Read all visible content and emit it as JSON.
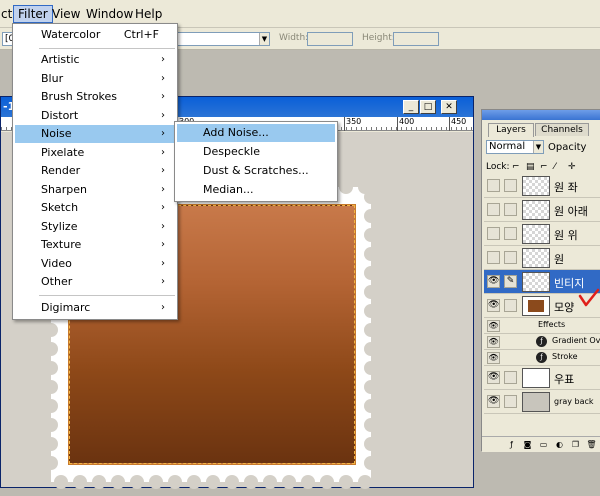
{
  "menubar": {
    "items": [
      {
        "label": "ct"
      },
      {
        "label": "Filter"
      },
      {
        "label": "View"
      },
      {
        "label": "Window"
      },
      {
        "label": "Help"
      }
    ]
  },
  "options": {
    "field_value": "[0",
    "width_label": "Width:",
    "height_label": "Height:"
  },
  "document": {
    "title": "-1",
    "ruler_ticks": [
      "300",
      "350",
      "400",
      "450"
    ]
  },
  "filter_menu": {
    "last_filter": "Watercolor",
    "last_filter_shortcut": "Ctrl+F",
    "items": [
      "Artistic",
      "Blur",
      "Brush Strokes",
      "Distort",
      "Noise",
      "Pixelate",
      "Render",
      "Sharpen",
      "Sketch",
      "Stylize",
      "Texture",
      "Video",
      "Other"
    ],
    "plugin": "Digimarc",
    "highlighted": "Noise"
  },
  "noise_menu": {
    "items": [
      "Add Noise...",
      "Despeckle",
      "Dust & Scratches...",
      "Median..."
    ],
    "highlighted": "Add Noise..."
  },
  "layers_panel": {
    "tabs": [
      "Layers",
      "Channels"
    ],
    "blend_mode": "Normal",
    "opacity_label": "Opacity",
    "lock_label": "Lock:",
    "layers": [
      {
        "name": "원 좌"
      },
      {
        "name": "원 아래"
      },
      {
        "name": "원 위"
      },
      {
        "name": "원"
      },
      {
        "name": "빈티지"
      },
      {
        "name": "모양"
      }
    ],
    "effects_label": "Effects",
    "effects": [
      "Gradient Ove",
      "Stroke"
    ],
    "bottom_layers": [
      {
        "name": "우표"
      },
      {
        "name": "gray back"
      }
    ]
  },
  "colors": {
    "menu_highlight": "#99c9ef",
    "selected_layer": "#316ac5",
    "stamp_top": "#c8794a",
    "stamp_bottom": "#6b3310",
    "annotation_red": "#e0201a"
  }
}
